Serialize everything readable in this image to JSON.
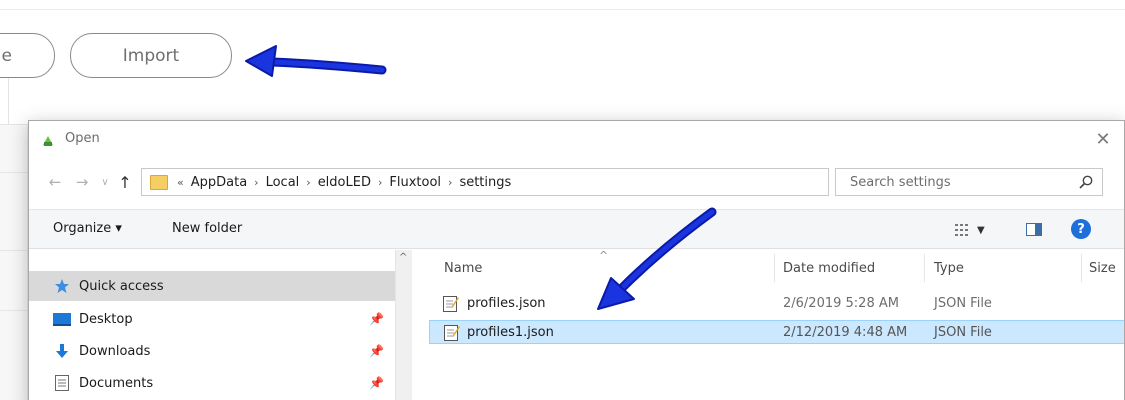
{
  "app": {
    "partial_button_label": "e",
    "import_button_label": "Import"
  },
  "dialog": {
    "title": "Open",
    "close_label": "✕",
    "nav": {
      "back": "←",
      "forward": "→",
      "recent": "∨",
      "up": "↑"
    },
    "address": {
      "prefix": "«",
      "crumbs": [
        "AppData",
        "Local",
        "eldoLED",
        "Fluxtool",
        "settings"
      ],
      "separator": "›",
      "dropdown": "∨",
      "refresh": "↻"
    },
    "search": {
      "placeholder": "Search settings"
    },
    "toolbar": {
      "organize_label": "Organize ▾",
      "new_folder_label": "New folder",
      "help_label": "?"
    },
    "nav_pane": {
      "scroll_up": "^",
      "items": [
        {
          "label": "Quick access",
          "icon": "star-icon",
          "pinned": false
        },
        {
          "label": "Desktop",
          "icon": "desktop-icon",
          "pinned": true
        },
        {
          "label": "Downloads",
          "icon": "download-icon",
          "pinned": true
        },
        {
          "label": "Documents",
          "icon": "document-icon",
          "pinned": true
        }
      ]
    },
    "columns": [
      "Name",
      "Date modified",
      "Type",
      "Size"
    ],
    "files": [
      {
        "name": "profiles.json",
        "date_modified": "2/6/2019 5:28 AM",
        "type": "JSON File",
        "selected": false
      },
      {
        "name": "profiles1.json",
        "date_modified": "2/12/2019 4:48 AM",
        "type": "JSON File",
        "selected": true
      }
    ]
  },
  "colors": {
    "arrow": "#1326c9",
    "selection": "#cce8ff",
    "selection_border": "#99d1ff",
    "help_blue": "#1e6fd9",
    "folder_yellow": "#f5cf63"
  }
}
